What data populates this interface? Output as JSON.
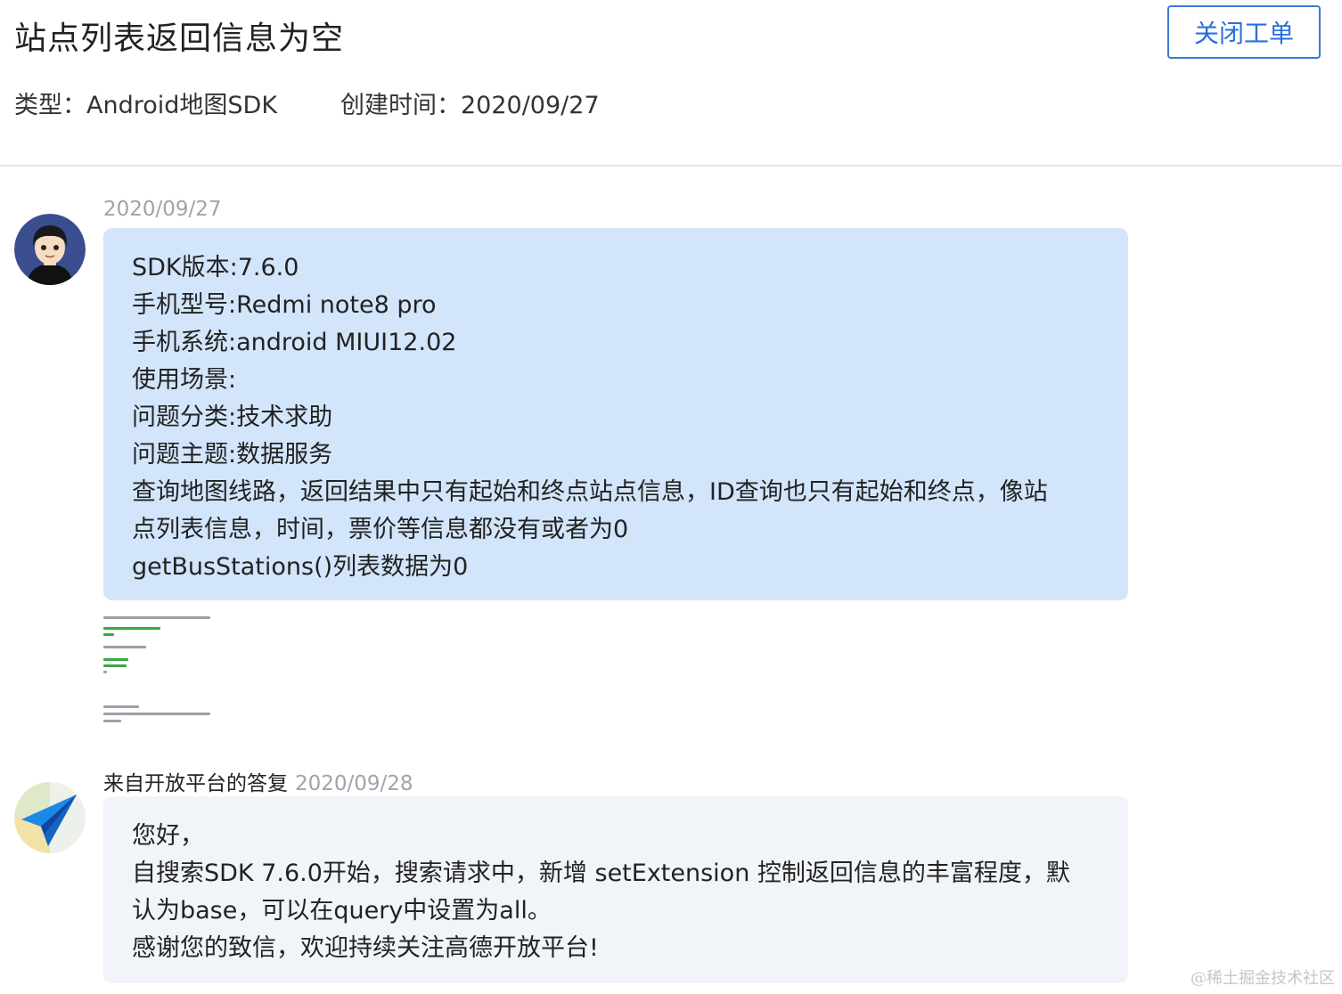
{
  "ticket": {
    "title": "站点列表返回信息为空",
    "close_label": "关闭工单",
    "type_text": "类型：Android地图SDK",
    "created_text": "创建时间：2020/09/27"
  },
  "messages": {
    "user": {
      "date": "2020/09/27",
      "lines": [
        "SDK版本:7.6.0",
        "手机型号:Redmi note8 pro",
        "手机系统:android MIUI12.02",
        "使用场景:",
        "问题分类:技术求助",
        "问题主题:数据服务",
        "查询地图线路，返回结果中只有起始和终点站点信息，ID查询也只有起始和终点，像站",
        "点列表信息，时间，票价等信息都没有或者为0",
        "getBusStations()列表数据为0"
      ]
    },
    "reply": {
      "source": "来自开放平台的答复",
      "date": "2020/09/28",
      "lines": [
        "您好，",
        "自搜索SDK 7.6.0开始，搜索请求中，新增 setExtension 控制返回信息的丰富程度，默",
        "认为base，可以在query中设置为all。",
        "感谢您的致信，欢迎持续关注高德开放平台!"
      ]
    }
  },
  "watermark": "@稀土掘金技术社区",
  "icons": {
    "user_avatar": "user-avatar",
    "bot_avatar": "paper-plane-icon"
  },
  "colors": {
    "accent": "#2a6fdb",
    "user_bubble": "#d3e5fb",
    "reply_bubble": "#f1f5f9"
  }
}
